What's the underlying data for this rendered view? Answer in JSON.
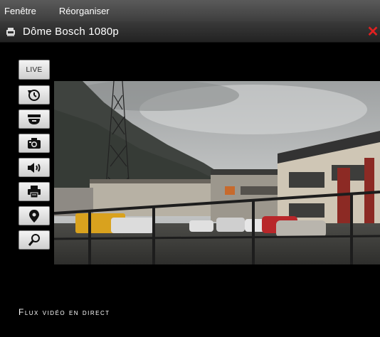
{
  "menubar": {
    "items": [
      {
        "label": "Fenêtre"
      },
      {
        "label": "Réorganiser"
      }
    ]
  },
  "window": {
    "title": "Dôme Bosch 1080p",
    "title_icon": "camera-icon",
    "close_icon": "close-icon",
    "close_color": "#e02020"
  },
  "toolbar": {
    "live_label": "LIVE",
    "buttons": [
      {
        "icon": "playback-icon"
      },
      {
        "icon": "dome-camera-icon"
      },
      {
        "icon": "snapshot-camera-icon"
      },
      {
        "icon": "audio-speaker-icon"
      },
      {
        "icon": "print-icon"
      },
      {
        "icon": "location-pin-icon"
      },
      {
        "icon": "zoom-magnifier-icon"
      }
    ]
  },
  "status": {
    "text": "Flux vidéo en direct"
  }
}
